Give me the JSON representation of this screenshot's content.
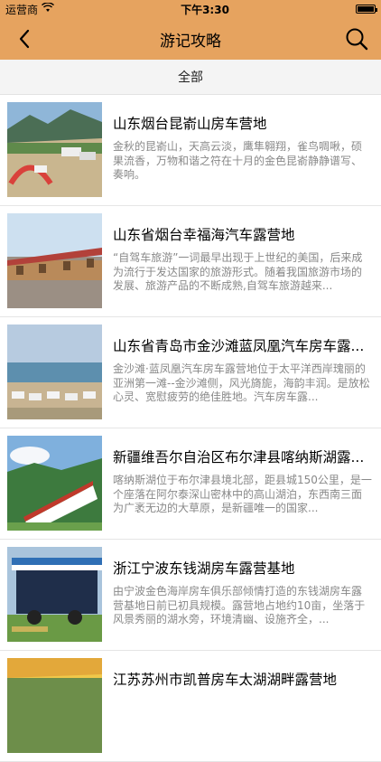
{
  "status_bar": {
    "carrier": "运营商",
    "time": "下午3:30"
  },
  "nav": {
    "title": "游记攻略"
  },
  "filter": {
    "label": "全部"
  },
  "items": [
    {
      "title": "山东烟台昆嵛山房车营地",
      "desc": "金秋的昆嵛山，天高云淡，鹰隼翱翔，雀鸟啁啾，硕果流香，万物和谐之符在十月的金色昆嵛静静谱写、奏响。"
    },
    {
      "title": "山东省烟台幸福海汽车露营地",
      "desc": "“自驾车旅游”一词最早出现于上世纪的美国，后来成为流行于发达国家的旅游形式。随着我国旅游市场的发展、旅游产品的不断成熟,自驾车旅游越来..."
    },
    {
      "title": "山东省青岛市金沙滩蓝凤凰汽车房车露...",
      "desc": "金沙滩·蓝凤凰汽车房车露营地位于太平洋西岸瑰丽的亚洲第一滩--金沙滩侧，风光旖旎，海韵丰润。是放松心灵、宽慰疲劳的绝佳胜地。汽车房车露..."
    },
    {
      "title": "新疆维吾尔自治区布尔津县喀纳斯湖露...",
      "desc": "喀纳斯湖位于布尔津县境北部，距县城150公里，是一个座落在阿尔泰深山密林中的高山湖泊，东西南三面为广袤无边的大草原，是新疆唯一的国家..."
    },
    {
      "title": "浙江宁波东钱湖房车露营基地",
      "desc": "由宁波金色海岸房车俱乐部倾情打造的东钱湖房车露营基地日前已初具规模。露营地占地约10亩，坐落于风景秀丽的湖水旁，环境清幽、设施齐全，..."
    },
    {
      "title": "江苏苏州市凯普房车太湖湖畔露营地",
      "desc": ""
    }
  ]
}
